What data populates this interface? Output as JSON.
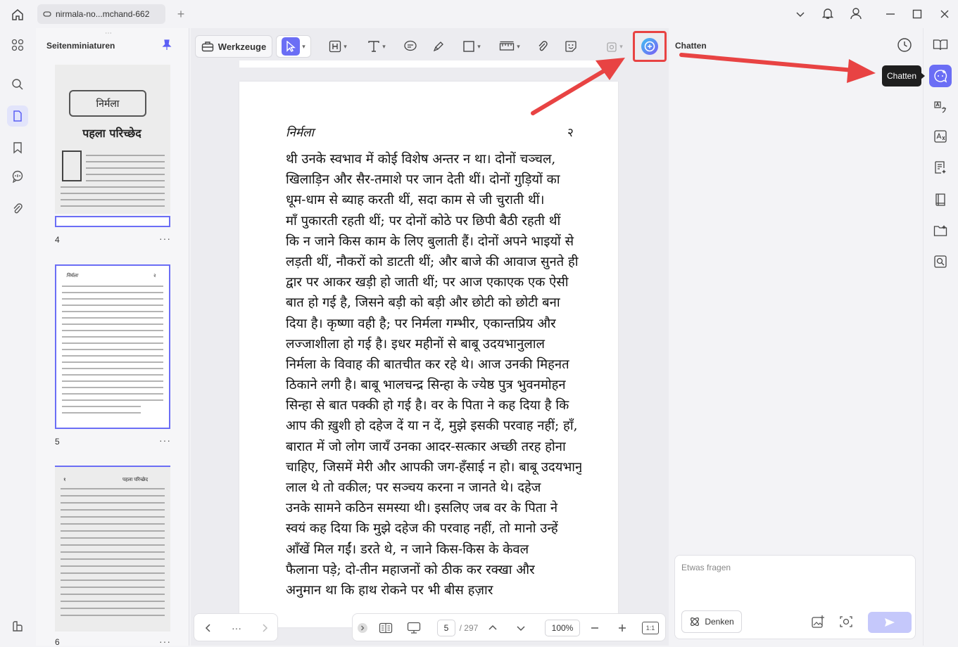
{
  "window": {
    "tab_title": "nirmala-no...mchand-662",
    "new_tab_icon": "plus-icon"
  },
  "thumbnails_panel": {
    "title": "Seitenminiaturen",
    "pages": [
      {
        "number": "4",
        "more": "···",
        "heading": "निर्मला",
        "subheading": "पहला परिच्छेद"
      },
      {
        "number": "5",
        "more": "···",
        "heading": "निर्मला",
        "page_mark": "२"
      },
      {
        "number": "6",
        "more": "···",
        "heading": "पहला परिच्छेद",
        "page_mark": "१"
      }
    ]
  },
  "toolbar": {
    "werkzeuge_label": "Werkzeuge"
  },
  "document": {
    "header_left": "निर्मला",
    "header_right": "२",
    "lines": [
      "थी उनके स्वभाव में कोई विशेष अन्तर न था। दोनों चञ्चल,",
      "खिलाड़िन और सैर-तमाशे पर जान देती थीं। दोनों गुड़ियों का",
      "धूम-धाम से ब्याह करती थीं, सदा काम से जी चुराती थीं।",
      "माँ पुकारती रहती थीं; पर दोनों कोठे पर छिपी बैठी रहती थीं",
      "कि न जाने किस काम के लिए बुलाती हैं। दोनों अपने भाइयों से",
      "लड़ती थीं, नौकरों को डाटती थीं; और बाजे की आवाज सुनते ही",
      "द्वार पर आकर खड़ी हो जाती थीं; पर आज एकाएक एक ऐसी",
      "बात हो गई है, जिसने बड़ी को बड़ी और छोटी को छोटी बना",
      "दिया है। कृष्णा वही है; पर निर्मला गम्भीर, एकान्तप्रिय और",
      "लज्जाशीला हो गई है। इधर महीनों से बाबू उदयभानुलाल",
      "निर्मला के विवाह की बातचीत कर रहे थे। आज उनकी मिहनत",
      "ठिकाने लगी है। बाबू भालचन्द्र सिन्हा के ज्येष्ठ पुत्र भुवनमोहन",
      "सिन्हा से बात पक्की हो गई है। वर के पिता ने कह दिया है कि",
      "आप की ख़ुशी हो दहेज दें या न दें, मुझे इसकी परवाह नहीं; हाँ,",
      "बारात में जो लोग जायँ उनका आदर-सत्कार अच्छी तरह होना",
      "चाहिए, जिसमें मेरी और आपकी जग-हँसाई न हो। बाबू उदयभानु-",
      "लाल थे तो वकील; पर सञ्चय करना न जानते थे। दहेज",
      "उनके सामने कठिन समस्या थी। इसलिए जब वर के पिता ने",
      "स्वयं कह दिया कि मुझे दहेज की परवाह नहीं, तो मानो उन्हें",
      "आँखें मिल गईं। डरते थे, न जाने किस-किस के केवल",
      "फैलाना पड़े; दो-तीन महाजनों को ठीक कर रक्खा और",
      "अनुमान था कि हाथ रोकने पर भी बीस हज़ार"
    ]
  },
  "bottom_nav": {
    "more": "···",
    "current_page": "5",
    "total_pages": "/ 297",
    "zoom": "100%",
    "fit_label": "1:1"
  },
  "chat_panel": {
    "title": "Chatten",
    "input_placeholder": "Etwas fragen",
    "denken_label": "Denken"
  },
  "right_rail": {
    "tooltip": "Chatten"
  },
  "annotation": {
    "arrow_color": "#e84343"
  }
}
